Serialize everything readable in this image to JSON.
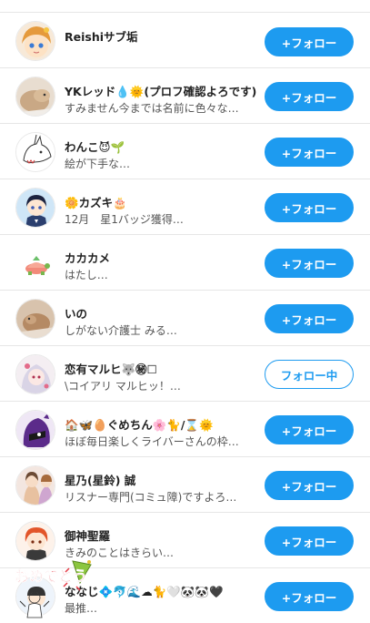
{
  "accounts": [
    {
      "name": "Reishiサブ垢",
      "bio": "",
      "button": "+フォロー",
      "following": false
    },
    {
      "name": "YKレッド💧🌞(プロフ確認よろです)",
      "bio": "すみません今までは名前に色々な…",
      "button": "+フォロー",
      "following": false
    },
    {
      "name": "わんこ😈🌱",
      "bio": "絵が下手な…",
      "button": "+フォロー",
      "following": false
    },
    {
      "name": "🌼カズキ🎂",
      "bio": "12月　星1バッジ獲得…",
      "button": "+フォロー",
      "following": false
    },
    {
      "name": "カカカメ",
      "bio": "はたし…",
      "button": "+フォロー",
      "following": false
    },
    {
      "name": "いの",
      "bio": "しがない介護士 みる…",
      "button": "+フォロー",
      "following": false
    },
    {
      "name": "恋有マルヒ🐺㊙☐",
      "bio": "\\コイアリ マルヒッ！…",
      "button": "フォロー中",
      "following": true
    },
    {
      "name": "🏠🦋🥚ぐめちん🌸🐈/⌛🌞",
      "bio": "ほぼ毎日楽しくライバーさんの枠…",
      "button": "+フォロー",
      "following": false
    },
    {
      "name": "星乃(星鈴) 誠",
      "bio": "リスナー専門(コミュ障)ですよろ…",
      "button": "+フォロー",
      "following": false
    },
    {
      "name": "御神聖羅",
      "bio": "きみのことはきらい…",
      "button": "+フォロー",
      "following": false
    },
    {
      "name": "ななじ💠🐬🌊☁🐈🤍🐼🐼🖤",
      "bio": "最推…",
      "button": "+フォロー",
      "following": false
    }
  ],
  "sticker": {
    "text": "おめでとう"
  },
  "colors": {
    "accent": "#1d9bf0",
    "divider": "#e6e6e6"
  }
}
